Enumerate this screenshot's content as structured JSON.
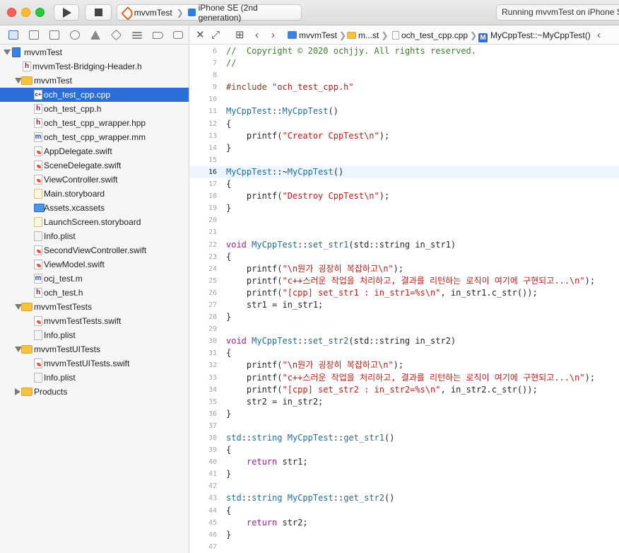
{
  "toolbar": {
    "scheme_name": "mvvmTest",
    "device": "iPhone SE (2nd generation)",
    "activity": "Running mvvmTest on iPhone SE"
  },
  "navigator": {
    "tree": [
      {
        "label": "mvvmTest",
        "kind": "proj",
        "depth": 0,
        "disclosure": "open"
      },
      {
        "label": "mvvmTest-Bridging-Header.h",
        "kind": "h",
        "depth": 1
      },
      {
        "label": "mvvmTest",
        "kind": "folder",
        "depth": 1,
        "disclosure": "open"
      },
      {
        "label": "och_test_cpp.cpp",
        "kind": "cpp",
        "depth": 2,
        "selected": true
      },
      {
        "label": "och_test_cpp.h",
        "kind": "h",
        "depth": 2
      },
      {
        "label": "och_test_cpp_wrapper.hpp",
        "kind": "h",
        "depth": 2
      },
      {
        "label": "och_test_cpp_wrapper.mm",
        "kind": "m",
        "depth": 2
      },
      {
        "label": "AppDelegate.swift",
        "kind": "swift",
        "depth": 2
      },
      {
        "label": "SceneDelegate.swift",
        "kind": "swift",
        "depth": 2
      },
      {
        "label": "ViewController.swift",
        "kind": "swift",
        "depth": 2
      },
      {
        "label": "Main.storyboard",
        "kind": "sb",
        "depth": 2
      },
      {
        "label": "Assets.xcassets",
        "kind": "assets",
        "depth": 2
      },
      {
        "label": "LaunchScreen.storyboard",
        "kind": "sb",
        "depth": 2
      },
      {
        "label": "Info.plist",
        "kind": "plist",
        "depth": 2
      },
      {
        "label": "SecondViewController.swift",
        "kind": "swift",
        "depth": 2
      },
      {
        "label": "ViewModel.swift",
        "kind": "swift",
        "depth": 2
      },
      {
        "label": "ocj_test.m",
        "kind": "m",
        "depth": 2
      },
      {
        "label": "och_test.h",
        "kind": "h",
        "depth": 2
      },
      {
        "label": "mvvmTestTests",
        "kind": "folder",
        "depth": 1,
        "disclosure": "open"
      },
      {
        "label": "mvvmTestTests.swift",
        "kind": "swift",
        "depth": 2
      },
      {
        "label": "Info.plist",
        "kind": "plist",
        "depth": 2
      },
      {
        "label": "mvvmTestUITests",
        "kind": "folder",
        "depth": 1,
        "disclosure": "open"
      },
      {
        "label": "mvvmTestUITests.swift",
        "kind": "swift",
        "depth": 2
      },
      {
        "label": "Info.plist",
        "kind": "plist",
        "depth": 2
      },
      {
        "label": "Products",
        "kind": "folder",
        "depth": 1,
        "disclosure": "closed"
      }
    ]
  },
  "jumpbar": {
    "project": "mvvmTest",
    "group": "m...st",
    "file": "och_test_cpp.cpp",
    "symbol_badge": "M",
    "symbol": "MyCppTest::~MyCppTest()"
  },
  "editor": {
    "current_line": 16,
    "lines": [
      {
        "n": 6,
        "tokens": [
          [
            "c",
            "//  Copyright © 2020 ochjjy. All rights reserved."
          ]
        ]
      },
      {
        "n": 7,
        "tokens": [
          [
            "c",
            "//"
          ]
        ]
      },
      {
        "n": 8,
        "tokens": []
      },
      {
        "n": 9,
        "tokens": [
          [
            "p",
            "#include "
          ],
          [
            "s",
            "\"och_test_cpp.h\""
          ]
        ]
      },
      {
        "n": 10,
        "tokens": []
      },
      {
        "n": 11,
        "tokens": [
          [
            "t",
            "MyCppTest"
          ],
          [
            "x",
            "::"
          ],
          [
            "t",
            "MyCppTest"
          ],
          [
            "x",
            "()"
          ]
        ]
      },
      {
        "n": 12,
        "tokens": [
          [
            "x",
            "{"
          ]
        ]
      },
      {
        "n": 13,
        "tokens": [
          [
            "x",
            "    printf("
          ],
          [
            "s",
            "\"Creator CppTest\\n\""
          ],
          [
            "x",
            ");"
          ]
        ]
      },
      {
        "n": 14,
        "tokens": [
          [
            "x",
            "}"
          ]
        ]
      },
      {
        "n": 15,
        "tokens": []
      },
      {
        "n": 16,
        "tokens": [
          [
            "t",
            "MyCppTest"
          ],
          [
            "x",
            "::~"
          ],
          [
            "t",
            "MyCppTest"
          ],
          [
            "x",
            "()"
          ]
        ]
      },
      {
        "n": 17,
        "tokens": [
          [
            "x",
            "{"
          ]
        ]
      },
      {
        "n": 18,
        "tokens": [
          [
            "x",
            "    printf("
          ],
          [
            "s",
            "\"Destroy CppTest\\n\""
          ],
          [
            "x",
            ");"
          ]
        ]
      },
      {
        "n": 19,
        "tokens": [
          [
            "x",
            "}"
          ]
        ]
      },
      {
        "n": 20,
        "tokens": []
      },
      {
        "n": 21,
        "tokens": []
      },
      {
        "n": 22,
        "tokens": [
          [
            "k",
            "void "
          ],
          [
            "t",
            "MyCppTest"
          ],
          [
            "x",
            "::"
          ],
          [
            "f",
            "set_str1"
          ],
          [
            "x",
            "(std::string in_str1)"
          ]
        ]
      },
      {
        "n": 23,
        "tokens": [
          [
            "x",
            "{"
          ]
        ]
      },
      {
        "n": 24,
        "tokens": [
          [
            "x",
            "    printf("
          ],
          [
            "s",
            "\"\\n뭔가 굉장히 복잡하고\\n\""
          ],
          [
            "x",
            ");"
          ]
        ]
      },
      {
        "n": 25,
        "tokens": [
          [
            "x",
            "    printf("
          ],
          [
            "s",
            "\"c++스러운 작업을 처리하고, 결과를 리턴하는 로직이 여기에 구현되고...\\n\""
          ],
          [
            "x",
            ");"
          ]
        ]
      },
      {
        "n": 26,
        "tokens": [
          [
            "x",
            "    printf("
          ],
          [
            "s",
            "\"[cpp] set_str1 : in_str1=%s\\n\""
          ],
          [
            "x",
            ", in_str1.c_str());"
          ]
        ]
      },
      {
        "n": 27,
        "tokens": [
          [
            "x",
            "    str1 = in_str1;"
          ]
        ]
      },
      {
        "n": 28,
        "tokens": [
          [
            "x",
            "}"
          ]
        ]
      },
      {
        "n": 29,
        "tokens": []
      },
      {
        "n": 30,
        "tokens": [
          [
            "k",
            "void "
          ],
          [
            "t",
            "MyCppTest"
          ],
          [
            "x",
            "::"
          ],
          [
            "f",
            "set_str2"
          ],
          [
            "x",
            "(std::string in_str2)"
          ]
        ]
      },
      {
        "n": 31,
        "tokens": [
          [
            "x",
            "{"
          ]
        ]
      },
      {
        "n": 32,
        "tokens": [
          [
            "x",
            "    printf("
          ],
          [
            "s",
            "\"\\n뭔가 굉장히 복잡하고\\n\""
          ],
          [
            "x",
            ");"
          ]
        ]
      },
      {
        "n": 33,
        "tokens": [
          [
            "x",
            "    printf("
          ],
          [
            "s",
            "\"c++스러운 작업을 처리하고, 결과를 리턴하는 로직이 여기에 구현되고...\\n\""
          ],
          [
            "x",
            ");"
          ]
        ]
      },
      {
        "n": 34,
        "tokens": [
          [
            "x",
            "    printf("
          ],
          [
            "s",
            "\"[cpp] set_str2 : in_str2=%s\\n\""
          ],
          [
            "x",
            ", in_str2.c_str());"
          ]
        ]
      },
      {
        "n": 35,
        "tokens": [
          [
            "x",
            "    str2 = in_str2;"
          ]
        ]
      },
      {
        "n": 36,
        "tokens": [
          [
            "x",
            "}"
          ]
        ]
      },
      {
        "n": 37,
        "tokens": []
      },
      {
        "n": 38,
        "tokens": [
          [
            "t",
            "std"
          ],
          [
            "x",
            "::"
          ],
          [
            "t",
            "string "
          ],
          [
            "t",
            "MyCppTest"
          ],
          [
            "x",
            "::"
          ],
          [
            "f",
            "get_str1"
          ],
          [
            "x",
            "()"
          ]
        ]
      },
      {
        "n": 39,
        "tokens": [
          [
            "x",
            "{"
          ]
        ]
      },
      {
        "n": 40,
        "tokens": [
          [
            "k",
            "    return "
          ],
          [
            "x",
            "str1;"
          ]
        ]
      },
      {
        "n": 41,
        "tokens": [
          [
            "x",
            "}"
          ]
        ]
      },
      {
        "n": 42,
        "tokens": []
      },
      {
        "n": 43,
        "tokens": [
          [
            "t",
            "std"
          ],
          [
            "x",
            "::"
          ],
          [
            "t",
            "string "
          ],
          [
            "t",
            "MyCppTest"
          ],
          [
            "x",
            "::"
          ],
          [
            "f",
            "get_str2"
          ],
          [
            "x",
            "()"
          ]
        ]
      },
      {
        "n": 44,
        "tokens": [
          [
            "x",
            "{"
          ]
        ]
      },
      {
        "n": 45,
        "tokens": [
          [
            "k",
            "    return "
          ],
          [
            "x",
            "str2;"
          ]
        ]
      },
      {
        "n": 46,
        "tokens": [
          [
            "x",
            "}"
          ]
        ]
      },
      {
        "n": 47,
        "tokens": []
      }
    ]
  }
}
